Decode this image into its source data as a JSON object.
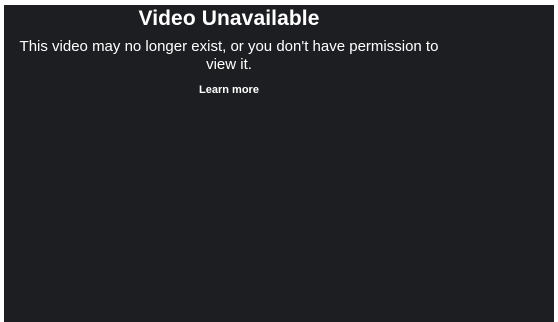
{
  "video_error": {
    "title": "Video Unavailable",
    "message": "This video may no longer exist, or you don't have permission to view it.",
    "learn_more_label": "Learn more"
  },
  "colors": {
    "player_background": "#1d1e21",
    "page_background": "#ffffff",
    "text": "#ffffff"
  }
}
